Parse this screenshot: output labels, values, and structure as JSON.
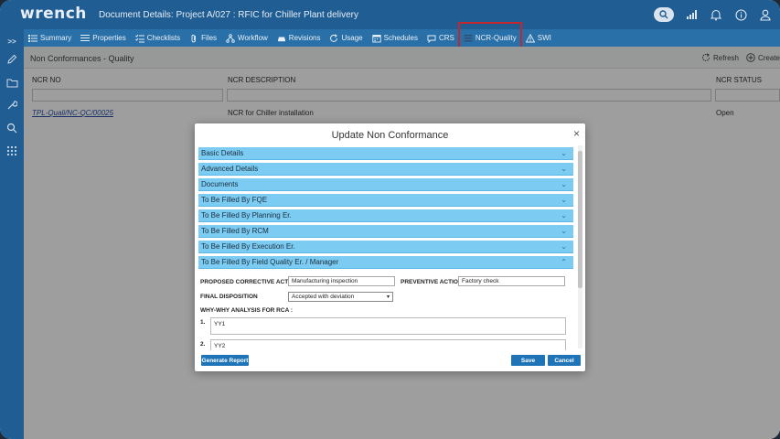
{
  "app": {
    "logo": "wrench",
    "document_title": "Document Details: Project A/027 : RFIC for Chiller Plant delivery"
  },
  "top_icons": [
    "search-icon",
    "signal-icon",
    "bell-icon",
    "info-icon",
    "user-icon"
  ],
  "tabs": [
    {
      "label": "Summary",
      "icon": "list-icon"
    },
    {
      "label": "Properties",
      "icon": "properties-icon"
    },
    {
      "label": "Checklists",
      "icon": "checklist-icon"
    },
    {
      "label": "Files",
      "icon": "paperclip-icon"
    },
    {
      "label": "Workflow",
      "icon": "workflow-icon"
    },
    {
      "label": "Revisions",
      "icon": "revisions-icon"
    },
    {
      "label": "Usage",
      "icon": "usage-icon"
    },
    {
      "label": "Schedules",
      "icon": "calendar-icon"
    },
    {
      "label": "CRS",
      "icon": "comment-icon"
    },
    {
      "label": "NCR-Quality",
      "icon": "quality-icon"
    },
    {
      "label": "SWI",
      "icon": "warning-icon"
    }
  ],
  "sidebar": {
    "toggle": ">>",
    "icons": [
      "pencil-icon",
      "folder-icon",
      "wrench-icon",
      "search-icon",
      "apps-grid-icon"
    ]
  },
  "section": {
    "title": "Non Conformances - Quality",
    "refresh_label": "Refresh",
    "create_label": "Create"
  },
  "grid": {
    "columns": [
      "NCR NO",
      "NCR DESCRIPTION",
      "NCR STATUS"
    ],
    "rows": [
      {
        "ncr_no": "TPL-Quali/NC-QC/00025",
        "description": "NCR for Chiller installation",
        "status": "Open"
      }
    ]
  },
  "modal": {
    "title": "Update Non Conformance",
    "close": "×",
    "sections": [
      {
        "label": "Basic Details",
        "expanded": false
      },
      {
        "label": "Advanced Details",
        "expanded": false
      },
      {
        "label": "Documents",
        "expanded": false
      },
      {
        "label": "To Be Filled By FQE",
        "expanded": false
      },
      {
        "label": "To Be Filled By Planning Er.",
        "expanded": false
      },
      {
        "label": "To Be Filled By RCM",
        "expanded": false
      },
      {
        "label": "To Be Filled By Execution Er.",
        "expanded": false
      },
      {
        "label": "To Be Filled By Field Quality Er. / Manager",
        "expanded": true
      }
    ],
    "form": {
      "corrective_action_label": "PROPOSED CORRECTIVE ACTION",
      "corrective_action_value": "Manufacturing inspection",
      "preventive_action_label": "PREVENTIVE ACTION",
      "preventive_action_value": "Factory check",
      "final_disposition_label": "FINAL DISPOSITION",
      "final_disposition_value": "Accepted with deviation",
      "why_label": "WHY-WHY ANALYSIS FOR RCA :",
      "why_items": [
        {
          "num": "1.",
          "value": "YY1"
        },
        {
          "num": "2.",
          "value": "YY2"
        }
      ]
    },
    "buttons": {
      "generate_report": "Generate Report",
      "save": "Save",
      "cancel": "Cancel"
    }
  },
  "colors": {
    "header": "#1f5d93",
    "tabbar": "#2a70a8",
    "accordion": "#7bcbf2",
    "button": "#1f74b8",
    "highlight": "#c0282d"
  }
}
